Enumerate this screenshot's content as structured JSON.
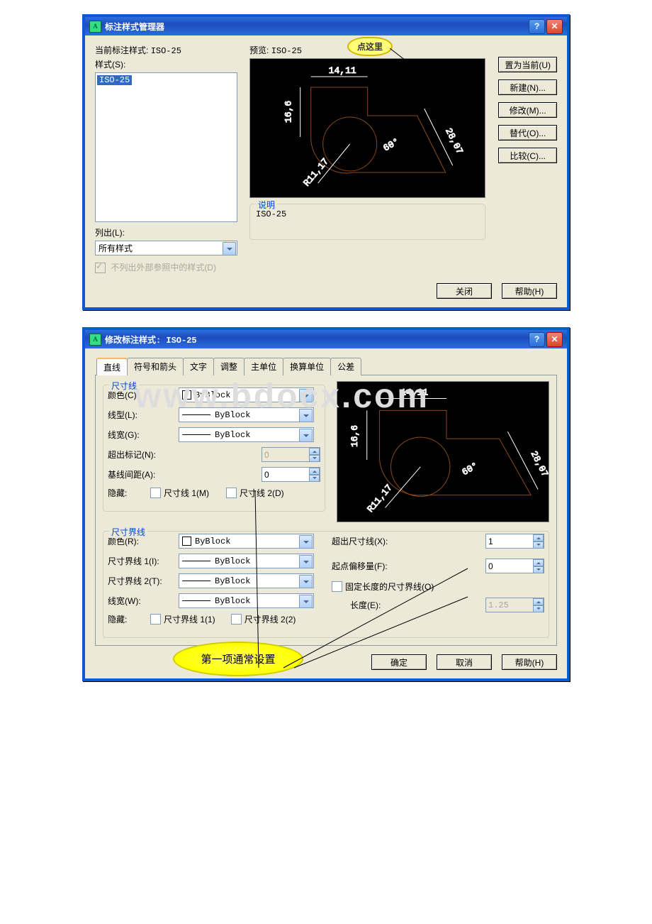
{
  "dialog1": {
    "title": "标注样式管理器",
    "current_label": "当前标注样式:",
    "current_value": "ISO-25",
    "styles_label": "样式(S):",
    "style_item": "ISO-25",
    "list_label": "列出(L):",
    "list_value": "所有样式",
    "xref_checkbox": "不列出外部参照中的样式(D)",
    "preview_label": "预览:",
    "preview_value": "ISO-25",
    "desc_label": "说明",
    "desc_value": "ISO-25",
    "btn_current": "置为当前(U)",
    "btn_new": "新建(N)...",
    "btn_modify": "修改(M)...",
    "btn_override": "替代(O)...",
    "btn_compare": "比较(C)...",
    "btn_close": "关闭",
    "btn_help": "帮助(H)",
    "callout_text": "点这里"
  },
  "dialog2": {
    "title": "修改标注样式: ISO-25",
    "tabs": [
      "直线",
      "符号和箭头",
      "文字",
      "调整",
      "主单位",
      "换算单位",
      "公差"
    ],
    "group1_title": "尺寸线",
    "color_label": "颜色(C):",
    "linetype_label": "线型(L):",
    "lineweight_label": "线宽(G):",
    "ext_ticks_label": "超出标记(N):",
    "ext_ticks_value": "0",
    "baseline_label": "基线间距(A):",
    "baseline_value": "0",
    "suppress_label": "隐藏:",
    "dimline1": "尺寸线 1(M)",
    "dimline2": "尺寸线 2(D)",
    "group2_title": "尺寸界线",
    "color2_label": "颜色(R):",
    "extline1_label": "尺寸界线 1(I):",
    "extline2_label": "尺寸界线 2(T):",
    "lineweight2_label": "线宽(W):",
    "suppress2_label": "隐藏:",
    "extline1_chk": "尺寸界线 1(1)",
    "extline2_chk": "尺寸界线 2(2)",
    "beyond_label": "超出尺寸线(X):",
    "beyond_value": "1",
    "offset_label": "起点偏移量(F):",
    "offset_value": "0",
    "fixed_label": "固定长度的尺寸界线(O)",
    "length_label": "长度(E):",
    "length_value": "1.25",
    "byblock": "ByBlock",
    "btn_ok": "确定",
    "btn_cancel": "取消",
    "btn_help": "帮助(H)",
    "callout_text": "第一项通常设置"
  },
  "preview_dims": {
    "top": "14,11",
    "left": "16,6",
    "right": "28,07",
    "angle": "60°",
    "radius": "R11,17"
  },
  "watermark": "www.bdocx.com"
}
